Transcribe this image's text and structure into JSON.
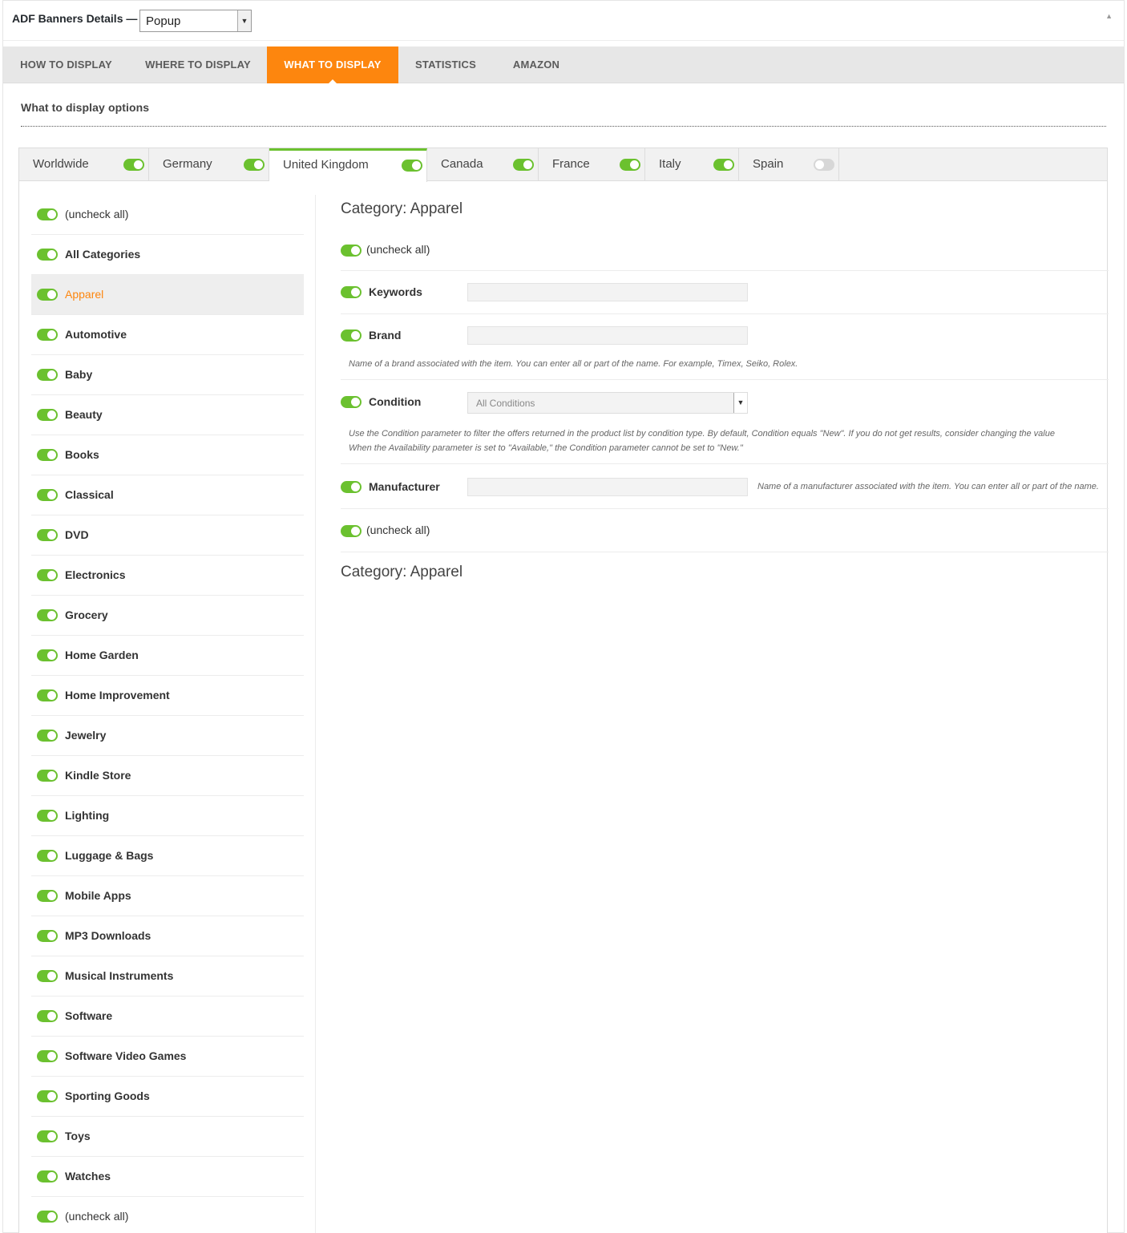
{
  "header": {
    "title": "ADF Banners Details —",
    "display_type": "Popup",
    "collapse_icon": "triangle-up-icon"
  },
  "nav": {
    "tabs": [
      {
        "label": "HOW TO DISPLAY"
      },
      {
        "label": "WHERE TO DISPLAY"
      },
      {
        "label": "WHAT TO DISPLAY",
        "active": true
      },
      {
        "label": "STATISTICS"
      },
      {
        "label": "AMAZON"
      }
    ]
  },
  "section": {
    "title": "What to display options"
  },
  "countries": [
    {
      "label": "Worldwide",
      "enabled": true
    },
    {
      "label": "Germany",
      "enabled": true
    },
    {
      "label": "United Kingdom",
      "enabled": true,
      "active": true
    },
    {
      "label": "Canada",
      "enabled": true
    },
    {
      "label": "France",
      "enabled": true
    },
    {
      "label": "Italy",
      "enabled": true
    },
    {
      "label": "Spain",
      "enabled": false
    }
  ],
  "categories": [
    {
      "label": "(uncheck all)"
    },
    {
      "label": "All Categories"
    },
    {
      "label": "Apparel",
      "selected": true
    },
    {
      "label": "Automotive"
    },
    {
      "label": "Baby"
    },
    {
      "label": "Beauty"
    },
    {
      "label": "Books"
    },
    {
      "label": "Classical"
    },
    {
      "label": "DVD"
    },
    {
      "label": "Electronics"
    },
    {
      "label": "Grocery"
    },
    {
      "label": "Home Garden"
    },
    {
      "label": "Home Improvement"
    },
    {
      "label": "Jewelry"
    },
    {
      "label": "Kindle Store"
    },
    {
      "label": "Lighting"
    },
    {
      "label": "Luggage & Bags"
    },
    {
      "label": "Mobile Apps"
    },
    {
      "label": "MP3 Downloads"
    },
    {
      "label": "Musical Instruments"
    },
    {
      "label": "Software"
    },
    {
      "label": "Software Video Games"
    },
    {
      "label": "Sporting Goods"
    },
    {
      "label": "Toys"
    },
    {
      "label": "Watches"
    },
    {
      "label": "(uncheck all)"
    }
  ],
  "detail": {
    "heading": "Category: Apparel",
    "uncheck_all": "(uncheck all)",
    "keywords_label": "Keywords",
    "keywords_value": "",
    "brand_label": "Brand",
    "brand_value": "",
    "brand_help": "Name of a brand associated with the item. You can enter all or part of the name. For example, Timex, Seiko, Rolex.",
    "condition_label": "Condition",
    "condition_value": "All Conditions",
    "condition_help_1": "Use the Condition parameter to filter the offers returned in the product list by condition type. By default, Condition equals \"New\". If you do not get results, consider changing the value",
    "condition_help_2": "When the Availability parameter is set to \"Available,\" the Condition parameter cannot be set to \"New.\"",
    "manufacturer_label": "Manufacturer",
    "manufacturer_value": "",
    "manufacturer_help": "Name of a manufacturer associated with the item. You can enter all or part of the name.",
    "uncheck_all_bottom": "(uncheck all)",
    "heading_bottom": "Category: Apparel"
  },
  "colors": {
    "accent": "#fd860e",
    "toggle_on": "#6bc12f",
    "toggle_off": "#d7d7d7"
  }
}
